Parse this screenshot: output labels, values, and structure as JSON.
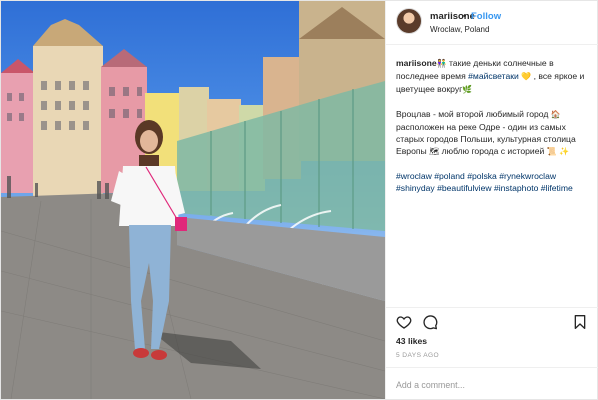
{
  "post": {
    "username": "mariisone",
    "separator": "•",
    "follow_label": "Follow",
    "location": "Wroclaw, Poland"
  },
  "caption": {
    "username": "mariisone",
    "p1_a": " такие деньки солнечные в последнее время ",
    "p1_tag": "#майсветаки",
    "p1_b": " , все яркое и цветущее вокруг",
    "p2_a": "Вроцлав - мой второй любимый город ",
    "p2_b": " расположен на реке Одре - один из самых старых городов Польши, культурная столица Европы ",
    "p2_c": " люблю города с историей ",
    "hashtags": [
      "#wroclaw",
      "#poland",
      "#polska",
      "#rynekwroclaw",
      "#shinyday",
      "#beautifulview",
      "#instaphoto",
      "#lifetime"
    ]
  },
  "stats": {
    "likes": "43 likes",
    "time_ago": "5 DAYS AGO"
  },
  "comment": {
    "placeholder": "Add a comment..."
  },
  "icons": {
    "like": "heart-icon",
    "comment": "comment-icon",
    "save": "bookmark-icon"
  },
  "colors": {
    "link": "#3897f0",
    "hashtag": "#003569",
    "muted": "#999999",
    "border": "#efefef"
  }
}
